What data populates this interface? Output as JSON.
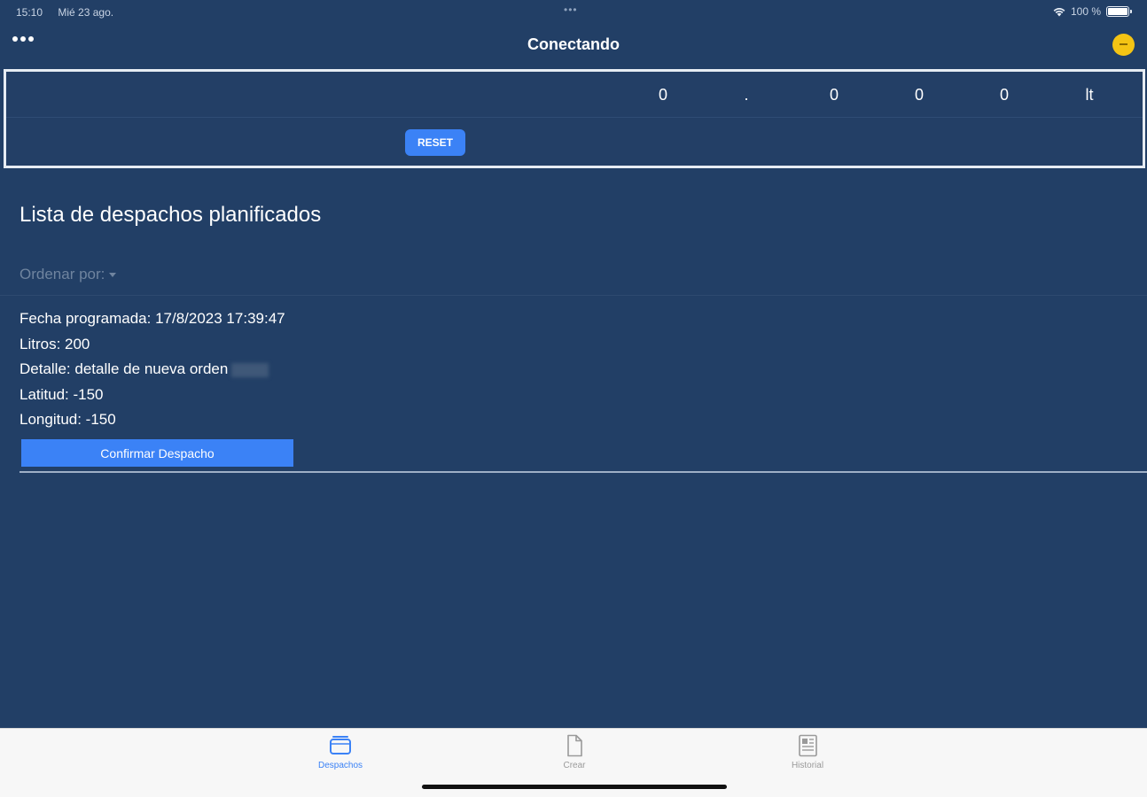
{
  "status_bar": {
    "time": "15:10",
    "date": "Mié 23 ago.",
    "battery": "100 %"
  },
  "nav": {
    "title": "Conectando"
  },
  "meter": {
    "digits": [
      "0",
      ".",
      "0",
      "0",
      "0",
      "lt"
    ],
    "reset_label": "RESET"
  },
  "page": {
    "title": "Lista de despachos planificados",
    "sort_label": "Ordenar por:"
  },
  "order": {
    "fecha": "Fecha programada: 17/8/2023 17:39:47",
    "litros": "Litros: 200",
    "detalle": "Detalle: detalle de nueva orden",
    "latitud": "Latitud: -150",
    "longitud": "Longitud: -150",
    "confirm_label": "Confirmar Despacho"
  },
  "tabs": [
    {
      "label": "Despachos",
      "icon": "tray-icon",
      "active": true
    },
    {
      "label": "Crear",
      "icon": "document-icon",
      "active": false
    },
    {
      "label": "Historial",
      "icon": "newspaper-icon",
      "active": false
    }
  ],
  "colors": {
    "background": "#223f66",
    "accent": "#3b82f6",
    "status": "#f4c414",
    "tabbar": "#f7f7f7"
  }
}
